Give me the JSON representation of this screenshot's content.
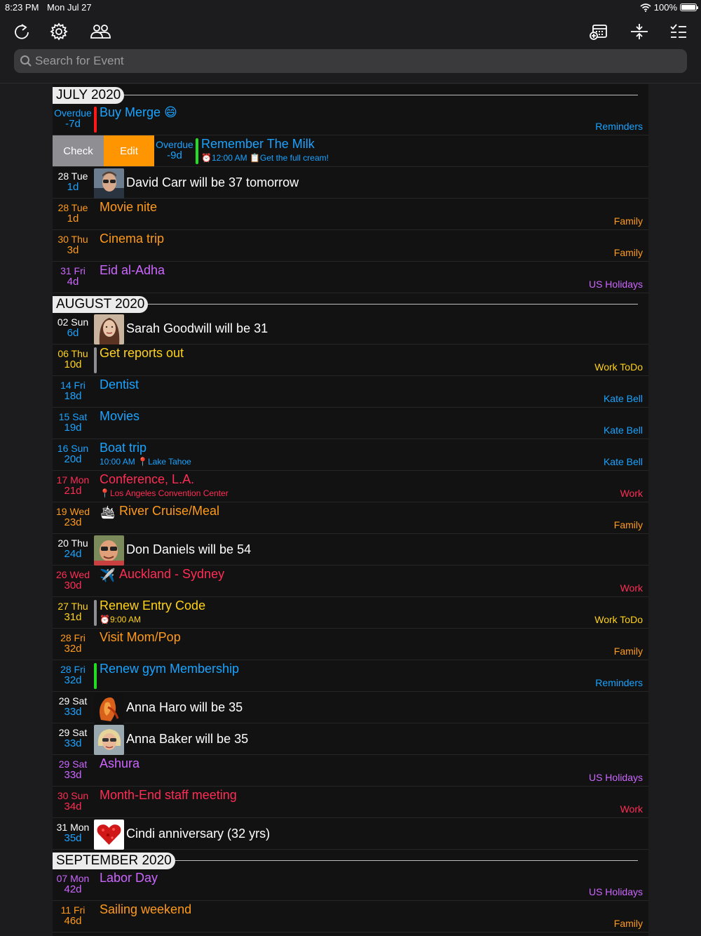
{
  "status": {
    "time": "8:23 PM",
    "date": "Mon Jul 27",
    "battery": "100%",
    "battery_level": 1.0
  },
  "toolbar": {
    "icons": [
      "refresh-icon",
      "gear-icon",
      "people-icon",
      "calendar-add-icon",
      "expand-collapse-icon",
      "checklist-icon"
    ]
  },
  "search": {
    "placeholder": "Search for Event"
  },
  "swipe_actions": {
    "check": "Check",
    "edit": "Edit"
  },
  "sections": [
    {
      "month": "JULY 2020",
      "rows": [
        {
          "d1": "Overdue",
          "d2": "-7d",
          "title": "Buy Merge",
          "emoji": "😄",
          "cal": "Reminders",
          "color": "#1aa3ff",
          "datecolor": "#1aa3ff",
          "bar": "#ff1a1a"
        },
        {
          "swipe": true,
          "d1": "Overdue",
          "d2": "-9d",
          "title": "Remember The Milk",
          "sub": "⏰12:00 AM 📋Get the full cream!",
          "color": "#1aa3ff",
          "datecolor": "#1aa3ff",
          "bar": "#22dd22"
        },
        {
          "d1": "28 Tue",
          "d2": "1d",
          "avatar": "male1",
          "title": "David Carr will be 37 tomorrow",
          "datecolor": "#fff",
          "d2color": "#1aa3ff"
        },
        {
          "d1": "28 Tue",
          "d2": "1d",
          "title": "Movie nite",
          "cal": "Family",
          "color": "#ff9a1a",
          "datecolor": "#ff9a1a"
        },
        {
          "d1": "30 Thu",
          "d2": "3d",
          "title": "Cinema trip",
          "cal": "Family",
          "color": "#ff9a1a",
          "datecolor": "#ff9a1a"
        },
        {
          "d1": "31 Fri",
          "d2": "4d",
          "title": "Eid al-Adha",
          "cal": "US Holidays",
          "color": "#cc66ff",
          "datecolor": "#cc66ff"
        }
      ]
    },
    {
      "month": "AUGUST 2020",
      "rows": [
        {
          "d1": "02 Sun",
          "d2": "6d",
          "avatar": "female1",
          "title": "Sarah Goodwill will be 31",
          "datecolor": "#fff",
          "d2color": "#1aa3ff"
        },
        {
          "d1": "06 Thu",
          "d2": "10d",
          "title": "Get reports out",
          "cal": "Work ToDo",
          "color": "#ffd21a",
          "datecolor": "#ffd21a",
          "bar": "#8e8e93"
        },
        {
          "d1": "14 Fri",
          "d2": "18d",
          "title": "Dentist",
          "cal": "Kate Bell",
          "color": "#1aa3ff",
          "datecolor": "#1aa3ff"
        },
        {
          "d1": "15 Sat",
          "d2": "19d",
          "title": "Movies",
          "cal": "Kate Bell",
          "color": "#1aa3ff",
          "datecolor": "#1aa3ff"
        },
        {
          "d1": "16 Sun",
          "d2": "20d",
          "title": "Boat trip",
          "sub": "10:00 AM  📍Lake Tahoe",
          "cal": "Kate Bell",
          "color": "#1aa3ff",
          "datecolor": "#1aa3ff"
        },
        {
          "d1": "17 Mon",
          "d2": "21d",
          "title": "Conference, L.A.",
          "sub": "📍Los Angeles Convention Center",
          "cal": "Work",
          "color": "#ff2d55",
          "datecolor": "#ff2d55"
        },
        {
          "d1": "19 Wed",
          "d2": "23d",
          "icon": "🛳",
          "title": "River Cruise/Meal",
          "cal": "Family",
          "color": "#ff9a1a",
          "datecolor": "#ff9a1a"
        },
        {
          "d1": "20 Thu",
          "d2": "24d",
          "avatar": "male2",
          "title": "Don Daniels will be 54",
          "datecolor": "#fff",
          "d2color": "#1aa3ff"
        },
        {
          "d1": "26 Wed",
          "d2": "30d",
          "icon": "✈️",
          "title": "Auckland - Sydney",
          "cal": "Work",
          "color": "#ff2d55",
          "datecolor": "#ff2d55"
        },
        {
          "d1": "27 Thu",
          "d2": "31d",
          "title": "Renew Entry Code",
          "sub": "⏰9:00 AM",
          "cal": "Work ToDo",
          "color": "#ffd21a",
          "datecolor": "#ffd21a",
          "bar": "#8e8e93"
        },
        {
          "d1": "28 Fri",
          "d2": "32d",
          "title": "Visit Mom/Pop",
          "cal": "Family",
          "color": "#ff9a1a",
          "datecolor": "#ff9a1a"
        },
        {
          "d1": "28 Fri",
          "d2": "32d",
          "title": "Renew gym Membership",
          "cal": "Reminders",
          "color": "#1aa3ff",
          "datecolor": "#1aa3ff",
          "bar": "#22dd22"
        },
        {
          "d1": "29 Sat",
          "d2": "33d",
          "avatar": "female2",
          "title": "Anna Haro will be 35",
          "datecolor": "#fff",
          "d2color": "#1aa3ff"
        },
        {
          "d1": "29 Sat",
          "d2": "33d",
          "avatar": "female3",
          "title": "Anna Baker will be 35",
          "datecolor": "#fff",
          "d2color": "#1aa3ff"
        },
        {
          "d1": "29 Sat",
          "d2": "33d",
          "title": "Ashura",
          "cal": "US Holidays",
          "color": "#cc66ff",
          "datecolor": "#cc66ff"
        },
        {
          "d1": "30 Sun",
          "d2": "34d",
          "title": "Month-End staff meeting",
          "cal": "Work",
          "color": "#ff2d55",
          "datecolor": "#ff2d55"
        },
        {
          "d1": "31 Mon",
          "d2": "35d",
          "avatar": "heart",
          "title": "Cindi anniversary (32 yrs)",
          "datecolor": "#fff",
          "d2color": "#1aa3ff"
        }
      ]
    },
    {
      "month": "SEPTEMBER 2020",
      "rows": [
        {
          "d1": "07 Mon",
          "d2": "42d",
          "title": "Labor Day",
          "cal": "US Holidays",
          "color": "#cc66ff",
          "datecolor": "#cc66ff"
        },
        {
          "d1": "11 Fri",
          "d2": "46d",
          "title": "Sailing weekend",
          "cal": "Family",
          "color": "#ff9a1a",
          "datecolor": "#ff9a1a"
        }
      ]
    }
  ]
}
